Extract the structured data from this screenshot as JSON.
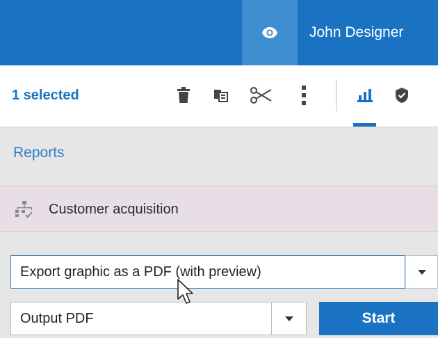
{
  "header": {
    "user_name": "John Designer",
    "preview_icon": "eye-icon"
  },
  "toolbar": {
    "selection_label": "1 selected",
    "icons": [
      "trash-icon",
      "copy-icon",
      "scissors-icon",
      "more-vert-icon",
      "bar-chart-icon",
      "shield-check-icon"
    ]
  },
  "breadcrumb": {
    "reports_label": "Reports"
  },
  "item": {
    "label": "Customer acquisition",
    "icon": "workflow-icon"
  },
  "controls": {
    "export_option": "Export graphic as a PDF (with preview)",
    "output_option": "Output PDF",
    "start_label": "Start"
  },
  "colors": {
    "accent": "#1a73c2",
    "header_highlight": "#3f8ed2",
    "item_background": "#e8dfe6",
    "panel_background": "#e6e6e6"
  }
}
